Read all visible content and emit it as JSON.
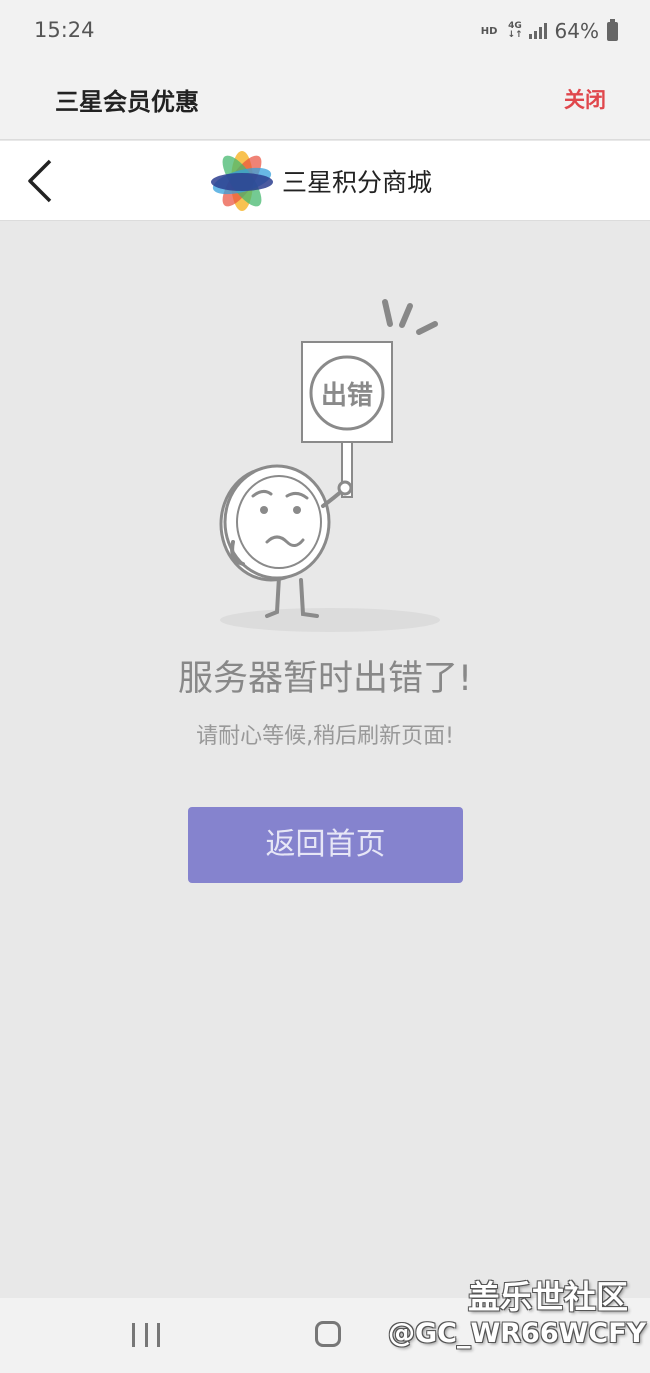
{
  "status_bar": {
    "time": "15:24",
    "hd": "HD",
    "network": "4G",
    "battery_pct": "64%"
  },
  "app_header": {
    "title": "三星会员优惠",
    "close_label": "关闭"
  },
  "nav": {
    "title": "三星积分商城",
    "back_icon": "chevron-left-icon",
    "logo_icon": "flower-logo-icon"
  },
  "error": {
    "sign_text": "出错",
    "title": "服务器暂时出错了!",
    "subtitle": "请耐心等候,稍后刷新页面!",
    "home_button": "返回首页"
  },
  "system_nav": {
    "recent_icon": "recent-apps-icon",
    "home_icon": "home-icon"
  },
  "watermark": {
    "site": "盖乐世社区",
    "user": "@GC_WR66WCFY"
  },
  "colors": {
    "accent": "#8583ce",
    "close": "#e0474c",
    "background": "#e8e8e8"
  }
}
